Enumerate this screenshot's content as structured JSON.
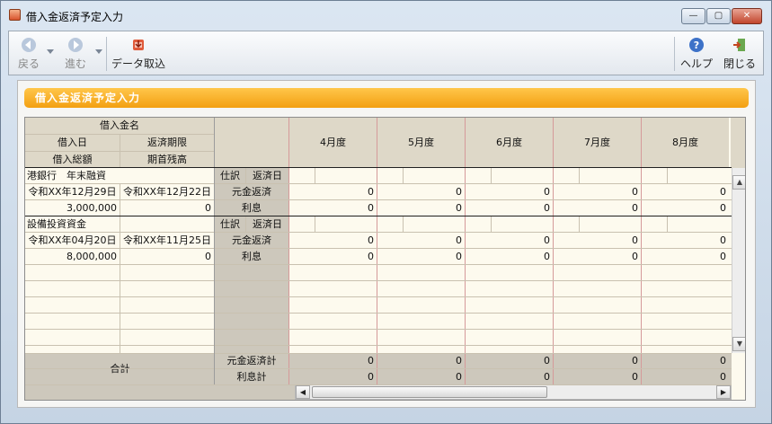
{
  "window": {
    "title": "借入金返済予定入力",
    "min_label": "—",
    "max_label": "▢",
    "close_label": "✕"
  },
  "toolbar": {
    "back_label": "戻る",
    "forward_label": "進む",
    "import_label": "データ取込",
    "help_label": "ヘルプ",
    "close_label": "閉じる"
  },
  "panel": {
    "title": "借入金返済予定入力"
  },
  "grid": {
    "header": {
      "loan_name": "借入金名",
      "borrow_date": "借入日",
      "due_date": "返済期限",
      "total_amount": "借入総額",
      "opening_balance": "期首残高"
    },
    "months": [
      "4月度",
      "5月度",
      "6月度",
      "7月度",
      "8月度"
    ],
    "labels": {
      "journal": "仕訳",
      "repay_date": "返済日",
      "principal": "元金返済",
      "interest": "利息"
    },
    "loans": [
      {
        "name": "港銀行　年末融資",
        "borrow_date": "令和XX年12月29日",
        "due_date": "令和XX年12月22日",
        "total": "3,000,000",
        "balance": "0",
        "principal": [
          "0",
          "0",
          "0",
          "0",
          "0"
        ],
        "interest": [
          "0",
          "0",
          "0",
          "0",
          "0"
        ]
      },
      {
        "name": "設備投資資金",
        "borrow_date": "令和XX年04月20日",
        "due_date": "令和XX年11月25日",
        "total": "8,000,000",
        "balance": "0",
        "principal": [
          "0",
          "0",
          "0",
          "0",
          "0"
        ],
        "interest": [
          "0",
          "0",
          "0",
          "0",
          "0"
        ]
      }
    ],
    "totals": {
      "label": "合計",
      "principal_label": "元金返済計",
      "interest_label": "利息計",
      "principal": [
        "0",
        "0",
        "0",
        "0",
        "0"
      ],
      "interest": [
        "0",
        "0",
        "0",
        "0",
        "0"
      ]
    }
  }
}
